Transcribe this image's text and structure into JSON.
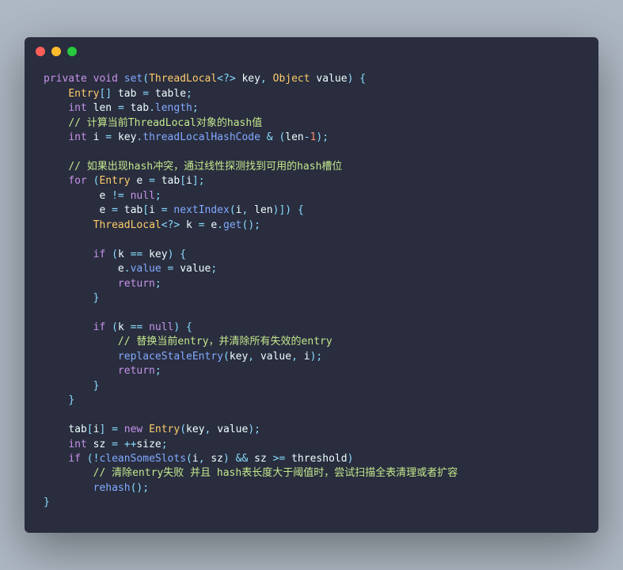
{
  "colors": {
    "background_page": "#aeb8c3",
    "background_window": "#292d3e",
    "dot_red": "#ff5f56",
    "dot_yellow": "#ffbd2e",
    "dot_green": "#27c93f",
    "keyword": "#c792ea",
    "type": "#ffcb6b",
    "function": "#82aaff",
    "identifier": "#eeffff",
    "operator": "#89ddff",
    "number": "#f78c6c",
    "comment": "#c3e88d",
    "plain": "#a6accd"
  },
  "code": {
    "tokens": [
      [
        {
          "t": "kw",
          "v": "private"
        },
        {
          "t": "pl",
          "v": " "
        },
        {
          "t": "kw",
          "v": "void"
        },
        {
          "t": "pl",
          "v": " "
        },
        {
          "t": "fn",
          "v": "set"
        },
        {
          "t": "pun",
          "v": "("
        },
        {
          "t": "type",
          "v": "ThreadLocal"
        },
        {
          "t": "pun",
          "v": "<"
        },
        {
          "t": "op",
          "v": "?"
        },
        {
          "t": "pun",
          "v": ">"
        },
        {
          "t": "pl",
          "v": " "
        },
        {
          "t": "id",
          "v": "key"
        },
        {
          "t": "pun",
          "v": ","
        },
        {
          "t": "pl",
          "v": " "
        },
        {
          "t": "type",
          "v": "Object"
        },
        {
          "t": "pl",
          "v": " "
        },
        {
          "t": "id",
          "v": "value"
        },
        {
          "t": "pun",
          "v": ")"
        },
        {
          "t": "pl",
          "v": " "
        },
        {
          "t": "pun",
          "v": "{"
        }
      ],
      [
        {
          "t": "pl",
          "v": "    "
        },
        {
          "t": "type",
          "v": "Entry"
        },
        {
          "t": "pun",
          "v": "[]"
        },
        {
          "t": "pl",
          "v": " "
        },
        {
          "t": "id",
          "v": "tab"
        },
        {
          "t": "pl",
          "v": " "
        },
        {
          "t": "op",
          "v": "="
        },
        {
          "t": "pl",
          "v": " "
        },
        {
          "t": "id",
          "v": "table"
        },
        {
          "t": "pun",
          "v": ";"
        }
      ],
      [
        {
          "t": "pl",
          "v": "    "
        },
        {
          "t": "kw",
          "v": "int"
        },
        {
          "t": "pl",
          "v": " "
        },
        {
          "t": "id",
          "v": "len"
        },
        {
          "t": "pl",
          "v": " "
        },
        {
          "t": "op",
          "v": "="
        },
        {
          "t": "pl",
          "v": " "
        },
        {
          "t": "id",
          "v": "tab"
        },
        {
          "t": "pun",
          "v": "."
        },
        {
          "t": "prop",
          "v": "length"
        },
        {
          "t": "pun",
          "v": ";"
        }
      ],
      [
        {
          "t": "pl",
          "v": "    "
        },
        {
          "t": "cmt",
          "v": "// 计算当前ThreadLocal对象的hash值"
        }
      ],
      [
        {
          "t": "pl",
          "v": "    "
        },
        {
          "t": "kw",
          "v": "int"
        },
        {
          "t": "pl",
          "v": " "
        },
        {
          "t": "id",
          "v": "i"
        },
        {
          "t": "pl",
          "v": " "
        },
        {
          "t": "op",
          "v": "="
        },
        {
          "t": "pl",
          "v": " "
        },
        {
          "t": "id",
          "v": "key"
        },
        {
          "t": "pun",
          "v": "."
        },
        {
          "t": "prop",
          "v": "threadLocalHashCode"
        },
        {
          "t": "pl",
          "v": " "
        },
        {
          "t": "op",
          "v": "&"
        },
        {
          "t": "pl",
          "v": " "
        },
        {
          "t": "pun",
          "v": "("
        },
        {
          "t": "id",
          "v": "len"
        },
        {
          "t": "op",
          "v": "-"
        },
        {
          "t": "num",
          "v": "1"
        },
        {
          "t": "pun",
          "v": ")"
        },
        {
          "t": "pun",
          "v": ";"
        }
      ],
      [],
      [
        {
          "t": "pl",
          "v": "    "
        },
        {
          "t": "cmt",
          "v": "// 如果出现hash冲突，通过线性探测找到可用的hash槽位"
        }
      ],
      [
        {
          "t": "pl",
          "v": "    "
        },
        {
          "t": "kw",
          "v": "for"
        },
        {
          "t": "pl",
          "v": " "
        },
        {
          "t": "pun",
          "v": "("
        },
        {
          "t": "type",
          "v": "Entry"
        },
        {
          "t": "pl",
          "v": " "
        },
        {
          "t": "id",
          "v": "e"
        },
        {
          "t": "pl",
          "v": " "
        },
        {
          "t": "op",
          "v": "="
        },
        {
          "t": "pl",
          "v": " "
        },
        {
          "t": "id",
          "v": "tab"
        },
        {
          "t": "pun",
          "v": "["
        },
        {
          "t": "id",
          "v": "i"
        },
        {
          "t": "pun",
          "v": "]"
        },
        {
          "t": "pun",
          "v": ";"
        }
      ],
      [
        {
          "t": "pl",
          "v": "         "
        },
        {
          "t": "id",
          "v": "e"
        },
        {
          "t": "pl",
          "v": " "
        },
        {
          "t": "op",
          "v": "!="
        },
        {
          "t": "pl",
          "v": " "
        },
        {
          "t": "kw",
          "v": "null"
        },
        {
          "t": "pun",
          "v": ";"
        }
      ],
      [
        {
          "t": "pl",
          "v": "         "
        },
        {
          "t": "id",
          "v": "e"
        },
        {
          "t": "pl",
          "v": " "
        },
        {
          "t": "op",
          "v": "="
        },
        {
          "t": "pl",
          "v": " "
        },
        {
          "t": "id",
          "v": "tab"
        },
        {
          "t": "pun",
          "v": "["
        },
        {
          "t": "id",
          "v": "i"
        },
        {
          "t": "pl",
          "v": " "
        },
        {
          "t": "op",
          "v": "="
        },
        {
          "t": "pl",
          "v": " "
        },
        {
          "t": "fn",
          "v": "nextIndex"
        },
        {
          "t": "pun",
          "v": "("
        },
        {
          "t": "id",
          "v": "i"
        },
        {
          "t": "pun",
          "v": ","
        },
        {
          "t": "pl",
          "v": " "
        },
        {
          "t": "id",
          "v": "len"
        },
        {
          "t": "pun",
          "v": ")"
        },
        {
          "t": "pun",
          "v": "]"
        },
        {
          "t": "pun",
          "v": ")"
        },
        {
          "t": "pl",
          "v": " "
        },
        {
          "t": "pun",
          "v": "{"
        }
      ],
      [
        {
          "t": "pl",
          "v": "        "
        },
        {
          "t": "type",
          "v": "ThreadLocal"
        },
        {
          "t": "pun",
          "v": "<"
        },
        {
          "t": "op",
          "v": "?"
        },
        {
          "t": "pun",
          "v": ">"
        },
        {
          "t": "pl",
          "v": " "
        },
        {
          "t": "id",
          "v": "k"
        },
        {
          "t": "pl",
          "v": " "
        },
        {
          "t": "op",
          "v": "="
        },
        {
          "t": "pl",
          "v": " "
        },
        {
          "t": "id",
          "v": "e"
        },
        {
          "t": "pun",
          "v": "."
        },
        {
          "t": "fn",
          "v": "get"
        },
        {
          "t": "pun",
          "v": "("
        },
        {
          "t": "pun",
          "v": ")"
        },
        {
          "t": "pun",
          "v": ";"
        }
      ],
      [],
      [
        {
          "t": "pl",
          "v": "        "
        },
        {
          "t": "kw",
          "v": "if"
        },
        {
          "t": "pl",
          "v": " "
        },
        {
          "t": "pun",
          "v": "("
        },
        {
          "t": "id",
          "v": "k"
        },
        {
          "t": "pl",
          "v": " "
        },
        {
          "t": "op",
          "v": "=="
        },
        {
          "t": "pl",
          "v": " "
        },
        {
          "t": "id",
          "v": "key"
        },
        {
          "t": "pun",
          "v": ")"
        },
        {
          "t": "pl",
          "v": " "
        },
        {
          "t": "pun",
          "v": "{"
        }
      ],
      [
        {
          "t": "pl",
          "v": "            "
        },
        {
          "t": "id",
          "v": "e"
        },
        {
          "t": "pun",
          "v": "."
        },
        {
          "t": "prop",
          "v": "value"
        },
        {
          "t": "pl",
          "v": " "
        },
        {
          "t": "op",
          "v": "="
        },
        {
          "t": "pl",
          "v": " "
        },
        {
          "t": "id",
          "v": "value"
        },
        {
          "t": "pun",
          "v": ";"
        }
      ],
      [
        {
          "t": "pl",
          "v": "            "
        },
        {
          "t": "kw",
          "v": "return"
        },
        {
          "t": "pun",
          "v": ";"
        }
      ],
      [
        {
          "t": "pl",
          "v": "        "
        },
        {
          "t": "pun",
          "v": "}"
        }
      ],
      [],
      [
        {
          "t": "pl",
          "v": "        "
        },
        {
          "t": "kw",
          "v": "if"
        },
        {
          "t": "pl",
          "v": " "
        },
        {
          "t": "pun",
          "v": "("
        },
        {
          "t": "id",
          "v": "k"
        },
        {
          "t": "pl",
          "v": " "
        },
        {
          "t": "op",
          "v": "=="
        },
        {
          "t": "pl",
          "v": " "
        },
        {
          "t": "kw",
          "v": "null"
        },
        {
          "t": "pun",
          "v": ")"
        },
        {
          "t": "pl",
          "v": " "
        },
        {
          "t": "pun",
          "v": "{"
        }
      ],
      [
        {
          "t": "pl",
          "v": "            "
        },
        {
          "t": "cmt",
          "v": "// 替换当前entry，并清除所有失效的entry"
        }
      ],
      [
        {
          "t": "pl",
          "v": "            "
        },
        {
          "t": "fn",
          "v": "replaceStaleEntry"
        },
        {
          "t": "pun",
          "v": "("
        },
        {
          "t": "id",
          "v": "key"
        },
        {
          "t": "pun",
          "v": ","
        },
        {
          "t": "pl",
          "v": " "
        },
        {
          "t": "id",
          "v": "value"
        },
        {
          "t": "pun",
          "v": ","
        },
        {
          "t": "pl",
          "v": " "
        },
        {
          "t": "id",
          "v": "i"
        },
        {
          "t": "pun",
          "v": ")"
        },
        {
          "t": "pun",
          "v": ";"
        }
      ],
      [
        {
          "t": "pl",
          "v": "            "
        },
        {
          "t": "kw",
          "v": "return"
        },
        {
          "t": "pun",
          "v": ";"
        }
      ],
      [
        {
          "t": "pl",
          "v": "        "
        },
        {
          "t": "pun",
          "v": "}"
        }
      ],
      [
        {
          "t": "pl",
          "v": "    "
        },
        {
          "t": "pun",
          "v": "}"
        }
      ],
      [],
      [
        {
          "t": "pl",
          "v": "    "
        },
        {
          "t": "id",
          "v": "tab"
        },
        {
          "t": "pun",
          "v": "["
        },
        {
          "t": "id",
          "v": "i"
        },
        {
          "t": "pun",
          "v": "]"
        },
        {
          "t": "pl",
          "v": " "
        },
        {
          "t": "op",
          "v": "="
        },
        {
          "t": "pl",
          "v": " "
        },
        {
          "t": "kw",
          "v": "new"
        },
        {
          "t": "pl",
          "v": " "
        },
        {
          "t": "type",
          "v": "Entry"
        },
        {
          "t": "pun",
          "v": "("
        },
        {
          "t": "id",
          "v": "key"
        },
        {
          "t": "pun",
          "v": ","
        },
        {
          "t": "pl",
          "v": " "
        },
        {
          "t": "id",
          "v": "value"
        },
        {
          "t": "pun",
          "v": ")"
        },
        {
          "t": "pun",
          "v": ";"
        }
      ],
      [
        {
          "t": "pl",
          "v": "    "
        },
        {
          "t": "kw",
          "v": "int"
        },
        {
          "t": "pl",
          "v": " "
        },
        {
          "t": "id",
          "v": "sz"
        },
        {
          "t": "pl",
          "v": " "
        },
        {
          "t": "op",
          "v": "="
        },
        {
          "t": "pl",
          "v": " "
        },
        {
          "t": "op",
          "v": "++"
        },
        {
          "t": "id",
          "v": "size"
        },
        {
          "t": "pun",
          "v": ";"
        }
      ],
      [
        {
          "t": "pl",
          "v": "    "
        },
        {
          "t": "kw",
          "v": "if"
        },
        {
          "t": "pl",
          "v": " "
        },
        {
          "t": "pun",
          "v": "("
        },
        {
          "t": "op",
          "v": "!"
        },
        {
          "t": "fn",
          "v": "cleanSomeSlots"
        },
        {
          "t": "pun",
          "v": "("
        },
        {
          "t": "id",
          "v": "i"
        },
        {
          "t": "pun",
          "v": ","
        },
        {
          "t": "pl",
          "v": " "
        },
        {
          "t": "id",
          "v": "sz"
        },
        {
          "t": "pun",
          "v": ")"
        },
        {
          "t": "pl",
          "v": " "
        },
        {
          "t": "op",
          "v": "&&"
        },
        {
          "t": "pl",
          "v": " "
        },
        {
          "t": "id",
          "v": "sz"
        },
        {
          "t": "pl",
          "v": " "
        },
        {
          "t": "op",
          "v": ">="
        },
        {
          "t": "pl",
          "v": " "
        },
        {
          "t": "id",
          "v": "threshold"
        },
        {
          "t": "pun",
          "v": ")"
        }
      ],
      [
        {
          "t": "pl",
          "v": "        "
        },
        {
          "t": "cmt",
          "v": "// 清除entry失败 并且 hash表长度大于阈值时，尝试扫描全表清理或者扩容"
        }
      ],
      [
        {
          "t": "pl",
          "v": "        "
        },
        {
          "t": "fn",
          "v": "rehash"
        },
        {
          "t": "pun",
          "v": "("
        },
        {
          "t": "pun",
          "v": ")"
        },
        {
          "t": "pun",
          "v": ";"
        }
      ],
      [
        {
          "t": "pun",
          "v": "}"
        }
      ]
    ]
  }
}
